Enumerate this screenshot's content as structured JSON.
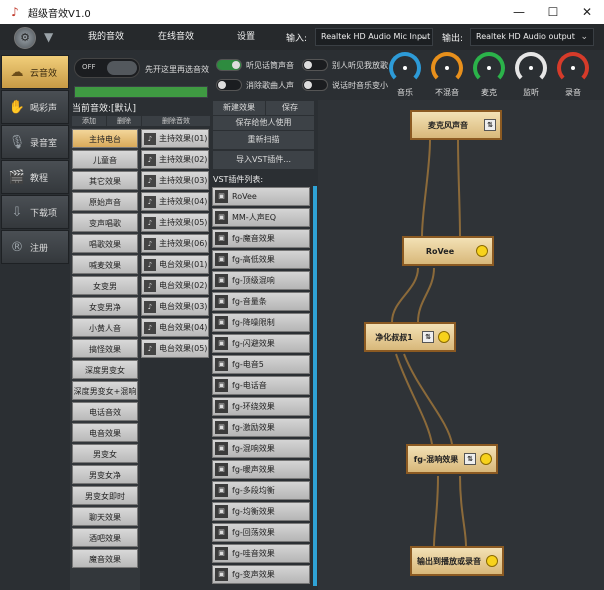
{
  "window": {
    "title": "超级音效V1.0"
  },
  "menu": [
    "我的音效",
    "在线音效",
    "设置"
  ],
  "input": {
    "label": "输入:",
    "value": "Realtek HD Audio Mic Input"
  },
  "output": {
    "label": "输出:",
    "value": "Realtek HD Audio output"
  },
  "nav": [
    {
      "label": "云音效",
      "icon": "cloud-icon"
    },
    {
      "label": "喝彩声",
      "icon": "applause-icon"
    },
    {
      "label": "录音室",
      "icon": "mic-icon"
    },
    {
      "label": "教程",
      "icon": "movie-icon"
    },
    {
      "label": "下载项",
      "icon": "download-icon"
    },
    {
      "label": "注册",
      "icon": "register-icon"
    }
  ],
  "controls": {
    "toggle_label": "OFF",
    "hint": "先开这里再选音效",
    "switches": [
      {
        "label": "听见话筒声音",
        "on": true
      },
      {
        "label": "别人听见我放歌",
        "on": false
      },
      {
        "label": "消除歌曲人声",
        "on": false
      },
      {
        "label": "说话时音乐变小",
        "on": false
      }
    ],
    "progress": 1.0
  },
  "knobs": [
    {
      "label": "音乐",
      "color": "#2d9bd8"
    },
    {
      "label": "不混音",
      "color": "#e8901c"
    },
    {
      "label": "麦克",
      "color": "#2bb34a"
    },
    {
      "label": "监听",
      "color": "#e6e6e6"
    },
    {
      "label": "录音",
      "color": "#d63b2a"
    }
  ],
  "preset": {
    "title": "当前音效:[默认]",
    "add": "添加",
    "delete": "删除",
    "delete_fx": "删除音效",
    "categories": [
      "主持电台",
      "儿童音",
      "其它效果",
      "原始声音",
      "变声唱歌",
      "唱歌效果",
      "喊麦效果",
      "女变男",
      "女变男净",
      "小黄人音",
      "搞怪效果",
      "深度男变女",
      "深度男变女+混响",
      "电话音效",
      "电音效果",
      "男变女",
      "男变女净",
      "男变女即时",
      "聊天效果",
      "酒吧效果",
      "魔音效果"
    ],
    "effects": [
      "主持效果(01)",
      "主持效果(02)",
      "主持效果(03)",
      "主持效果(04)",
      "主持效果(05)",
      "主持效果(06)",
      "电台效果(01)",
      "电台效果(02)",
      "电台效果(03)",
      "电台效果(04)",
      "电台效果(05)"
    ]
  },
  "middle": {
    "new_fx": "新建效果",
    "save": "保存",
    "save_for_others": "保存给他人使用",
    "rescan": "重新扫描",
    "import_vst": "导入VST插件...",
    "vst_title": "VST插件列表:",
    "vst": [
      "RoVee",
      "MM-人声EQ",
      "fg-魔音效果",
      "fg-高低效果",
      "fg-顶级混响",
      "fg-音量条",
      "fg-降噪限制",
      "fg-闪避效果",
      "fg-电音5",
      "fg-电话音",
      "fg-环绕效果",
      "fg-激励效果",
      "fg-混响效果",
      "fg-暖声效果",
      "fg-多段均衡",
      "fg-均衡效果",
      "fg-回荡效果",
      "fg-哇音效果",
      "fg-变声效果"
    ]
  },
  "graph": {
    "nodes": [
      "麦克风声音",
      "RoVee",
      "净化叔叔1",
      "fg-混响效果",
      "输出到播放或录音"
    ]
  }
}
